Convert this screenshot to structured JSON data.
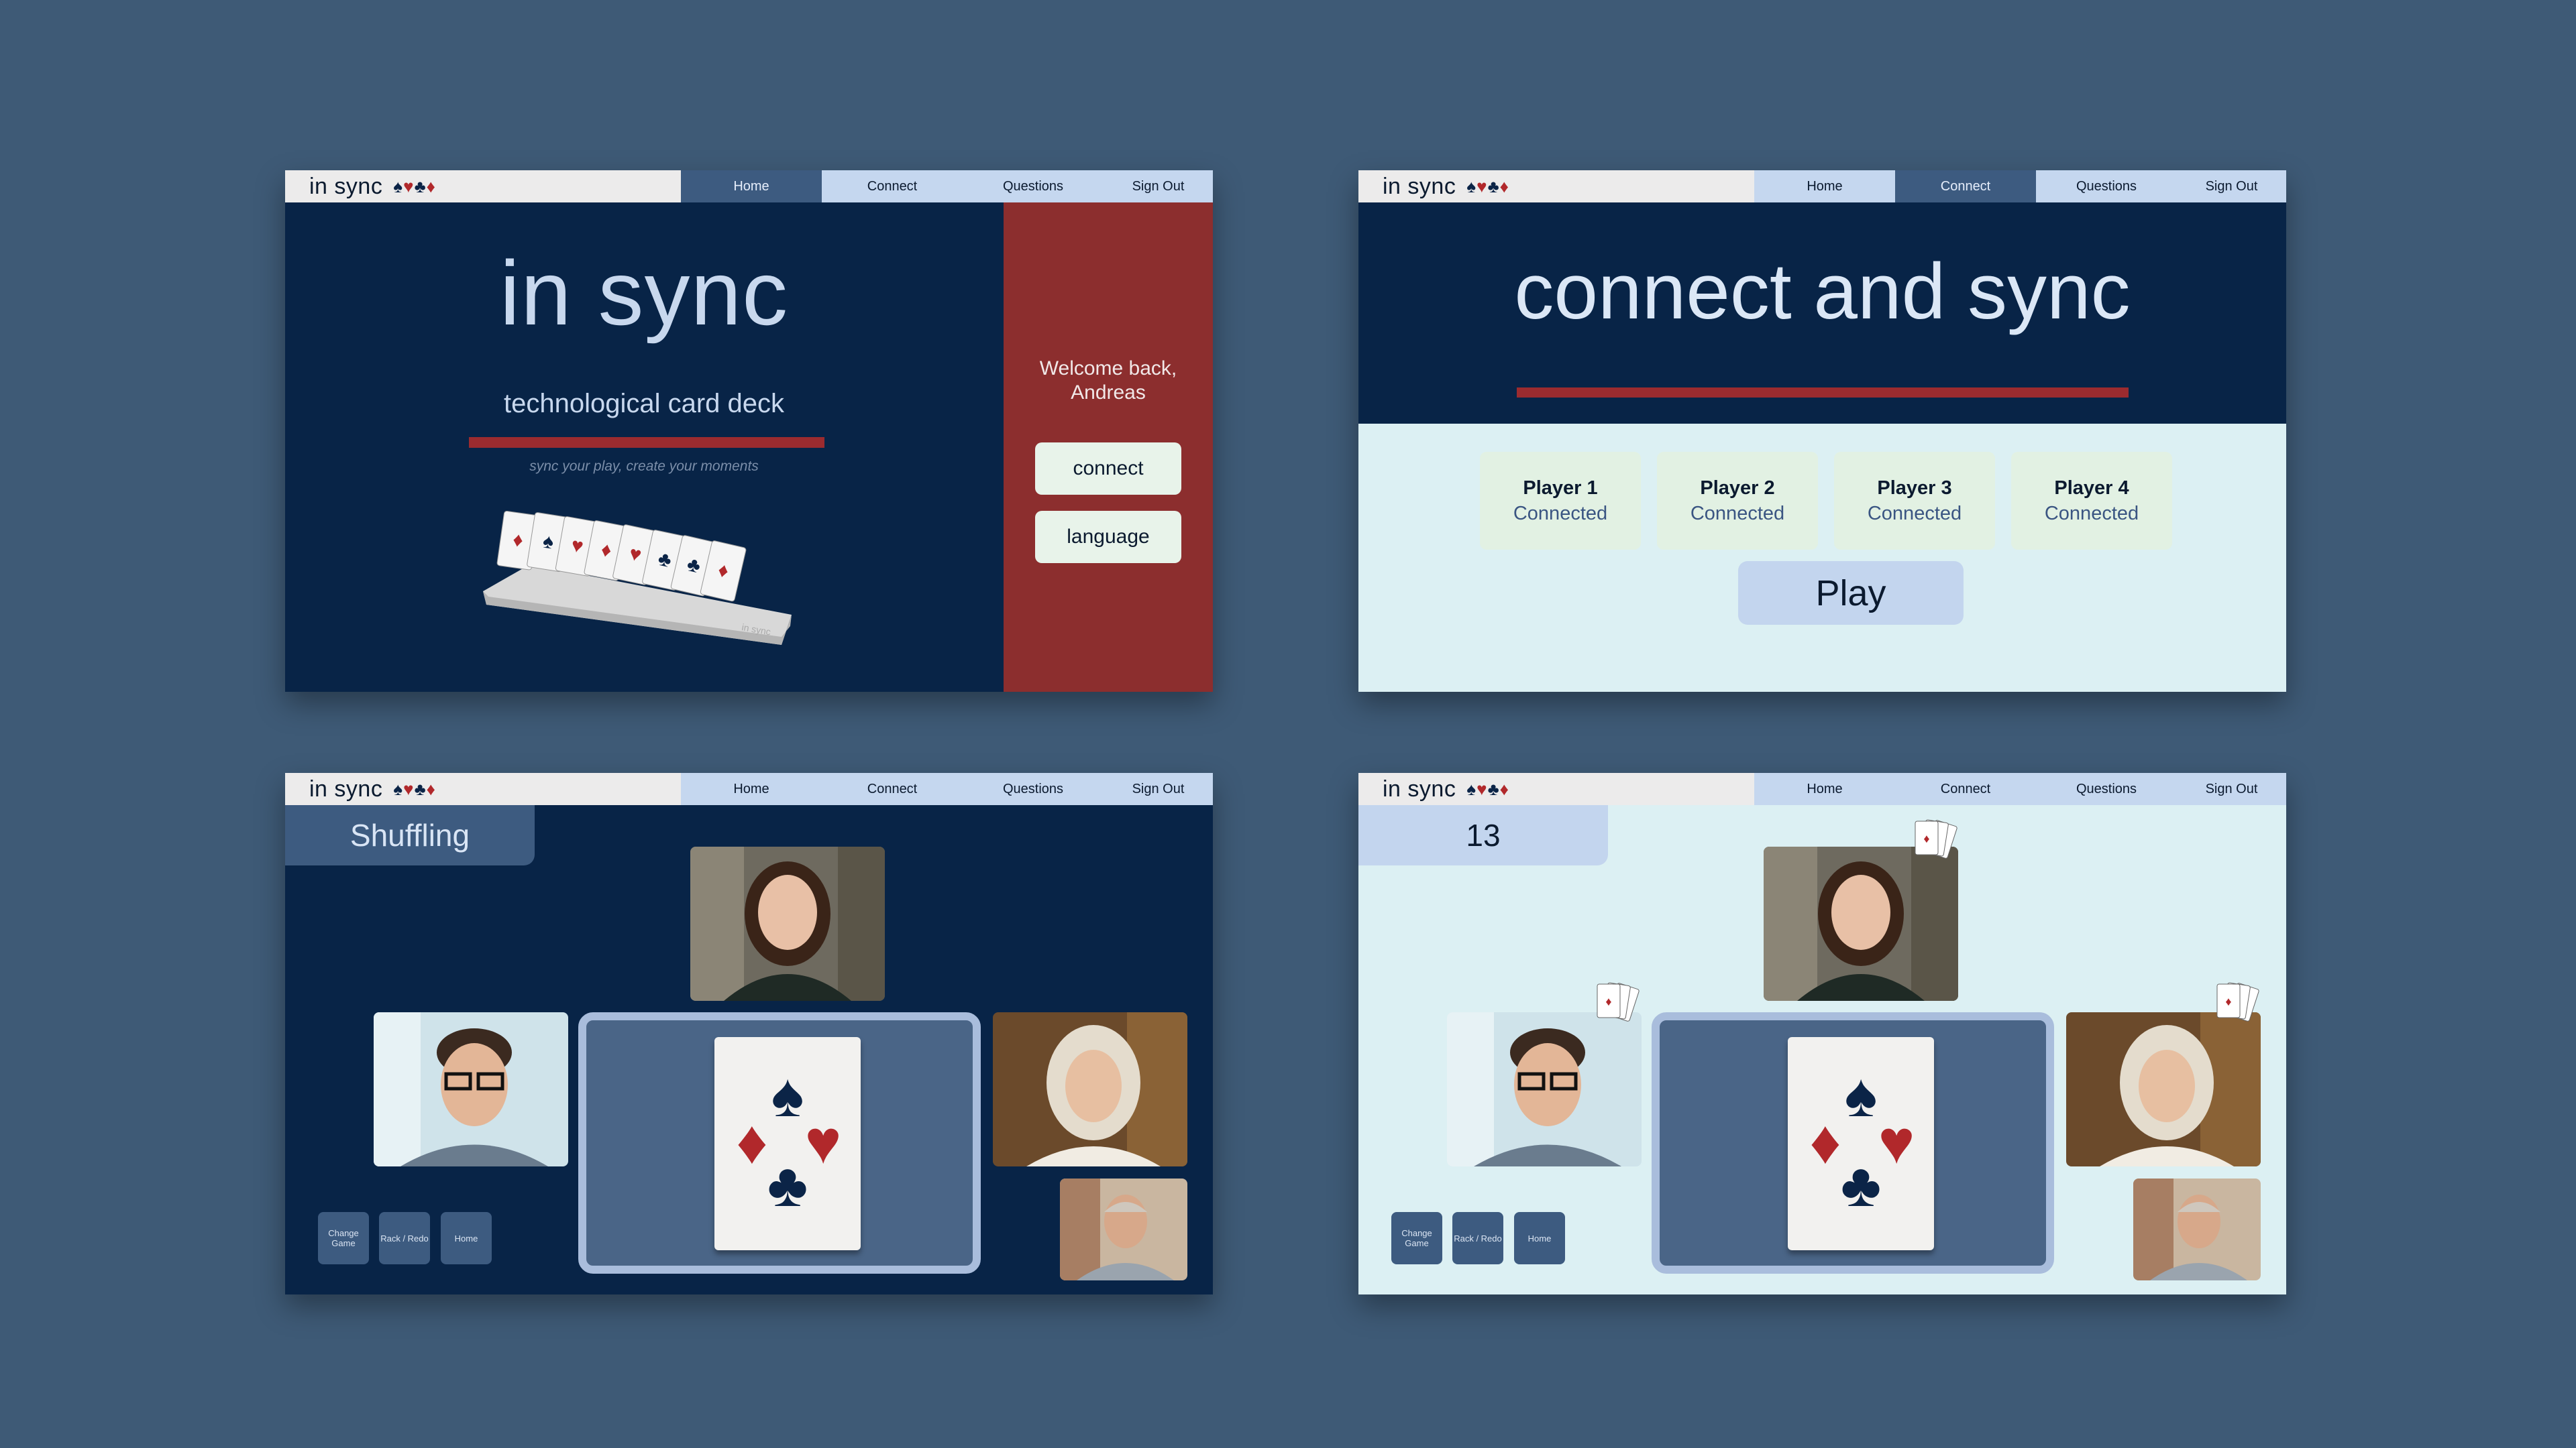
{
  "nav": {
    "brand": "in sync",
    "suits": [
      "♠",
      "♥",
      "♣",
      "♦"
    ],
    "items": [
      "Home",
      "Connect",
      "Questions",
      "Sign Out"
    ]
  },
  "home": {
    "title": "in sync",
    "subtitle": "technological card deck",
    "tagline": "sync your play, create your moments",
    "welcome": "Welcome back, Andreas",
    "connect_button": "connect",
    "language_button": "language",
    "rack_label": "in sync"
  },
  "connect": {
    "title": "connect and sync",
    "players": [
      {
        "name": "Player 1",
        "status": "Connected"
      },
      {
        "name": "Player 2",
        "status": "Connected"
      },
      {
        "name": "Player 3",
        "status": "Connected"
      },
      {
        "name": "Player 4",
        "status": "Connected"
      }
    ],
    "play_button": "Play"
  },
  "game_dark": {
    "status": "Shuffling",
    "controls": [
      "Change Game",
      "Rack / Redo",
      "Home"
    ]
  },
  "game_light": {
    "status": "13",
    "controls": [
      "Change Game",
      "Rack / Redo",
      "Home"
    ]
  },
  "colors": {
    "background": "#3e5a76",
    "navy": "#082447",
    "accent_red": "#9b2b2f",
    "light": "#dcf0f3",
    "nav_blue": "#c5d7ef"
  }
}
